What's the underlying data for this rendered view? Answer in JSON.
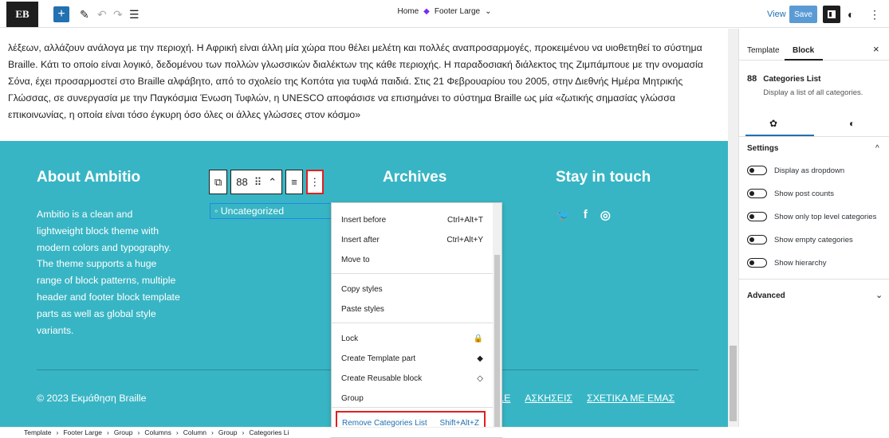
{
  "topbar": {
    "logo": "ΕΒ",
    "plus": "+",
    "pencil": "✎",
    "undo": "↶",
    "redo": "↷",
    "listview": "☰",
    "home": "Home",
    "template_name": "Footer Large",
    "chevron": "⌄",
    "view": "View",
    "save": "Save",
    "styles_icon": "◐",
    "more": "⋮"
  },
  "article": {
    "text": "λέξεων, αλλάζουν ανάλογα με την περιοχή. Η Αφρική είναι άλλη μία χώρα που θέλει μελέτη και πολλές αναπροσαρμογές, προκειμένου να υιοθετηθεί το σύστημα Braille. Κάτι το οποίο είναι λογικό, δεδομένου των πολλών γλωσσικών διαλέκτων της κάθε περιοχής. Η παραδοσιακή διάλεκτος της Ζιμπάμπουε με την ονομασία Σόνα, έχει προσαρμοστεί στο Braille αλφάβητο, από το σχολείο της Κοπότα για τυφλά παιδιά. Στις 21 Φεβρουαρίου του 2005, στην Διεθνής Ημέρα Μητρικής Γλώσσας, σε συνεργασία με την Παγκόσμια Ένωση Τυφλών, η UNESCO αποφάσισε να επισημάνει το σύστημα Braille ως μία «ζωτικής σημασίας γλώσσα επικοινωνίας, η οποία είναι τόσο έγκυρη όσο όλες οι άλλες γλώσσες στον κόσμο»"
  },
  "footer": {
    "about_heading": "About Ambitio",
    "about_text": "Ambitio is a clean and lightweight block theme with modern colors and typography. The theme supports a huge range of block patterns, multiple header and footer block template parts as well as global style variants.",
    "category": "◦ Uncategorized",
    "archives_heading": "Archives",
    "stay_heading": "Stay in touch",
    "twitter": "🐦",
    "facebook": "f",
    "instagram": "◎",
    "copyright": "© 2023 Εκμάθηση Braille",
    "nav": [
      "ILLE",
      "ΑΣΚΗΣΕΙΣ",
      "ΣΧΕΤΙΚΑ ΜΕ ΕΜΑΣ"
    ]
  },
  "toolbar": {
    "parent": "⧉",
    "grid": "88",
    "drag": "⠿",
    "move": "⌃",
    "align": "≡",
    "more": "⋮"
  },
  "menu": {
    "items": [
      {
        "label": "Insert before",
        "shortcut": "Ctrl+Alt+T"
      },
      {
        "label": "Insert after",
        "shortcut": "Ctrl+Alt+Y"
      },
      {
        "label": "Move to",
        "shortcut": ""
      },
      {
        "label": "Copy styles",
        "shortcut": ""
      },
      {
        "label": "Paste styles",
        "shortcut": ""
      },
      {
        "label": "Lock",
        "shortcut": "🔒"
      },
      {
        "label": "Create Template part",
        "shortcut": "◆"
      },
      {
        "label": "Create Reusable block",
        "shortcut": "◇"
      },
      {
        "label": "Group",
        "shortcut": ""
      }
    ],
    "remove": {
      "label": "Remove Categories List",
      "shortcut": "Shift+Alt+Z"
    }
  },
  "sidebar": {
    "tab_template": "Template",
    "tab_block": "Block",
    "close": "×",
    "block_icon": "88",
    "block_name": "Categories List",
    "block_desc": "Display a list of all categories.",
    "settings_icon": "✿",
    "styles_icon": "◐",
    "settings": "Settings",
    "settings_chevron": "^",
    "toggles": [
      "Display as dropdown",
      "Show post counts",
      "Show only top level categories",
      "Show empty categories",
      "Show hierarchy"
    ],
    "advanced": "Advanced",
    "advanced_chevron": "⌄"
  },
  "breadcrumb": [
    "Template",
    "Footer Large",
    "Group",
    "Columns",
    "Column",
    "Group",
    "Categories Li"
  ],
  "breadcrumb_sep": "›"
}
